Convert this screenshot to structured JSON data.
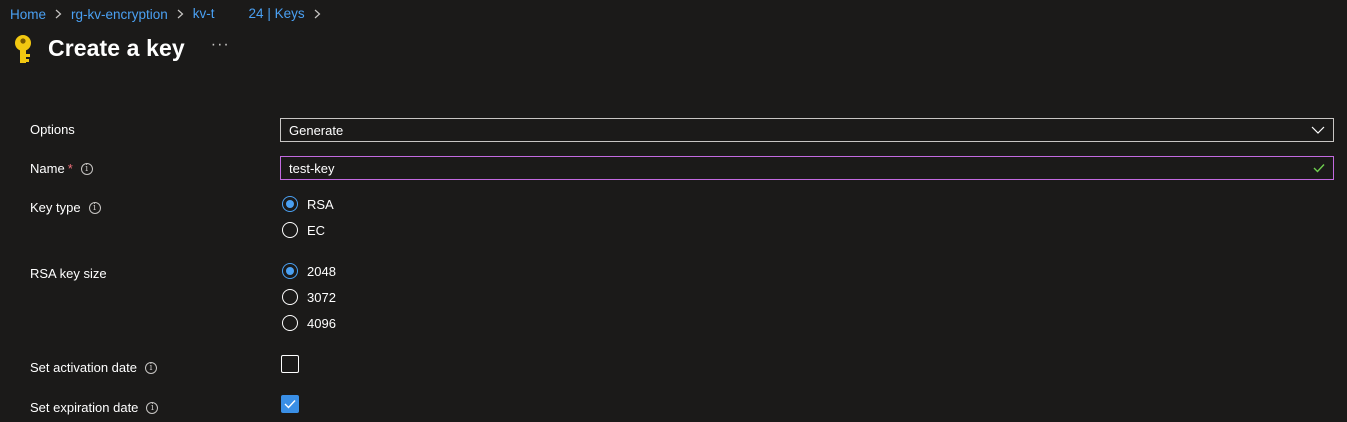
{
  "breadcrumb": {
    "items": [
      "Home",
      "rg-kv-encryption",
      "kv-t",
      "24 | Keys"
    ]
  },
  "header": {
    "title": "Create a key",
    "more_label": "···"
  },
  "form": {
    "options": {
      "label": "Options",
      "value": "Generate"
    },
    "name": {
      "label": "Name",
      "required_mark": "*",
      "value": "test-key"
    },
    "key_type": {
      "label": "Key type",
      "options": [
        "RSA",
        "EC"
      ],
      "selected": "RSA"
    },
    "rsa_key_size": {
      "label": "RSA key size",
      "options": [
        "2048",
        "3072",
        "4096"
      ],
      "selected": "2048"
    },
    "activation_date": {
      "label": "Set activation date",
      "checked": false
    },
    "expiration_date": {
      "label": "Set expiration date",
      "checked": true
    }
  },
  "colors": {
    "background": "#1b1a19",
    "link": "#4aa0f2",
    "accent": "#3a8fe6",
    "focus_border": "#c26ae0",
    "valid_check": "#6fcf4f",
    "required": "#f1707b",
    "key_icon": "#f2c811"
  },
  "icons": [
    "key-icon",
    "chevron-right-icon",
    "more-icon",
    "chevron-down-icon",
    "checkmark-icon",
    "info-icon"
  ]
}
